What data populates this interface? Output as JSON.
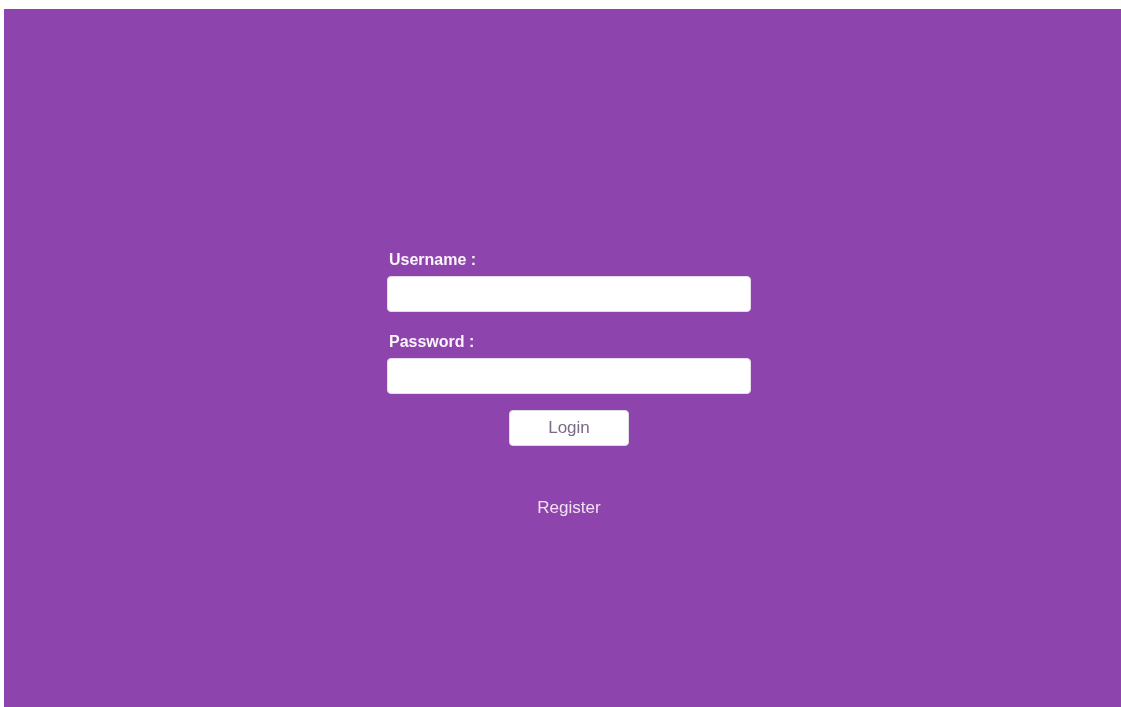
{
  "form": {
    "fields": [
      {
        "label": "Username :"
      },
      {
        "label": "Password :"
      }
    ],
    "login_button": "Login",
    "register_link": "Register"
  }
}
